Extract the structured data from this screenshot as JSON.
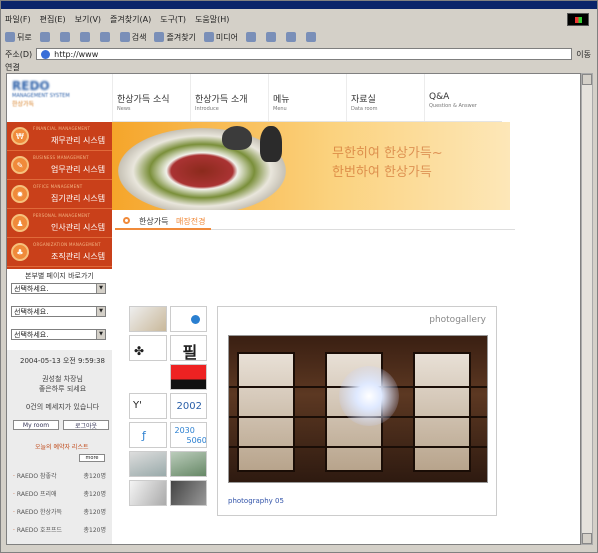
{
  "menubar": {
    "items": [
      "파일(F)",
      "편집(E)",
      "보기(V)",
      "즐겨찾기(A)",
      "도구(T)",
      "도움말(H)"
    ]
  },
  "toolbar": {
    "back": "뒤로",
    "search": "검색",
    "favorites": "즐겨찾기",
    "media": "미디어"
  },
  "address": {
    "label": "주소(D)",
    "url": "http://www",
    "go": "이동"
  },
  "links": {
    "label": "연결"
  },
  "logo": {
    "line1": "REDO",
    "line2": "MANAGEMENT SYSTEM",
    "line3": "한상가득"
  },
  "gnb": [
    {
      "ko": "한상가득 소식",
      "en": "News"
    },
    {
      "ko": "한상가득 소개",
      "en": "Introduce"
    },
    {
      "ko": "메뉴",
      "en": "Menu"
    },
    {
      "ko": "자료실",
      "en": "Data room"
    },
    {
      "ko": "Q&A",
      "en": "Question & Answer"
    }
  ],
  "banner": {
    "line1": "무한히여 한상가득~",
    "line2": "한번하여 한상가득"
  },
  "sysmenu": [
    {
      "en": "FINANCIAL MANAGEMENT",
      "ko": "재무관리 시스템"
    },
    {
      "en": "BUSINESS MANAGEMENT",
      "ko": "업무관리 시스템"
    },
    {
      "en": "OFFICE MANAGEMENT",
      "ko": "집기관리 시스템"
    },
    {
      "en": "PERSONAL MANAGEMENT",
      "ko": "인사관리 시스템"
    },
    {
      "en": "ORGANIZATION MANAGEMENT",
      "ko": "조직관리 시스템"
    }
  ],
  "quick": {
    "title": "본부별 페이지 바로가기",
    "selects": [
      "선택하세요.",
      "선택하세요.",
      "선택하세요."
    ]
  },
  "user": {
    "datetime": "2004-05-13 오전 9:59:38",
    "greeting1": "권성철 차장님",
    "greeting2": "좋은하루 되세요",
    "messages": "0건의 메세지가 있습니다",
    "myroom": "My room",
    "logout": "로그아웃"
  },
  "reservation": {
    "title": "오늘의 예약자 리스트",
    "more": "more",
    "rows": [
      {
        "name": "RAEDO 참좋각",
        "count": "총120명"
      },
      {
        "name": "RAEDO 프리애",
        "count": "총120명"
      },
      {
        "name": "RAEDO 한상가득",
        "count": "총120명"
      },
      {
        "name": "RAEDO 호프프드",
        "count": "총120명"
      }
    ]
  },
  "section": {
    "title1": "한상가득",
    "title2": "매장전경"
  },
  "thumbs": {
    "t2002": "2002",
    "t2030": "2030",
    "t5060": "5060"
  },
  "gallery": {
    "title": "photogallery",
    "caption": "photography 05"
  }
}
